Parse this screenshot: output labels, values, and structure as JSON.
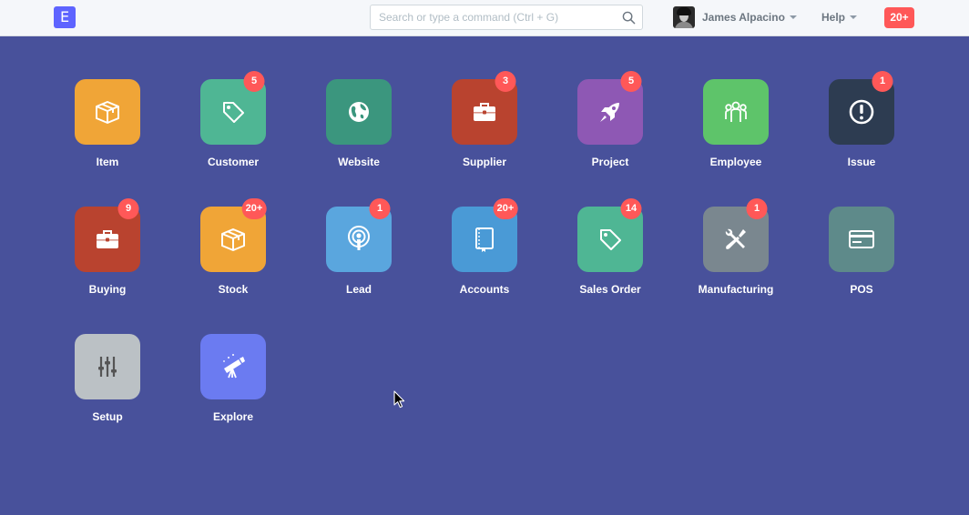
{
  "brand": {
    "letter": "E"
  },
  "search": {
    "placeholder": "Search or type a command (Ctrl + G)"
  },
  "user": {
    "name": "James Alpacino"
  },
  "help": {
    "label": "Help"
  },
  "notifications": {
    "count": "20+"
  },
  "colors": {
    "background": "#48519b",
    "navbar": "#f5f7fa",
    "badge": "#ff5858",
    "brand": "#5e64ff"
  },
  "modules": [
    {
      "label": "Item",
      "badge": "",
      "icon": "box-icon",
      "color": "#f0a537"
    },
    {
      "label": "Customer",
      "badge": "5",
      "icon": "tag-icon",
      "color": "#4fb694"
    },
    {
      "label": "Website",
      "badge": "",
      "icon": "globe-icon",
      "color": "#3b967e"
    },
    {
      "label": "Supplier",
      "badge": "3",
      "icon": "briefcase-icon",
      "color": "#b9432f"
    },
    {
      "label": "Project",
      "badge": "5",
      "icon": "rocket-icon",
      "color": "#8e58b4"
    },
    {
      "label": "Employee",
      "badge": "",
      "icon": "group-icon",
      "color": "#5ec46a"
    },
    {
      "label": "Issue",
      "badge": "1",
      "icon": "exclamation-icon",
      "color": "#2d3c51"
    },
    {
      "label": "Buying",
      "badge": "9",
      "icon": "briefcase-icon",
      "color": "#b9432f"
    },
    {
      "label": "Stock",
      "badge": "20+",
      "icon": "box-icon",
      "color": "#f0a537"
    },
    {
      "label": "Lead",
      "badge": "1",
      "icon": "podcast-icon",
      "color": "#5aa6de"
    },
    {
      "label": "Accounts",
      "badge": "20+",
      "icon": "book-icon",
      "color": "#4a9ad6"
    },
    {
      "label": "Sales Order",
      "badge": "14",
      "icon": "tag-icon",
      "color": "#4fb694"
    },
    {
      "label": "Manufacturing",
      "badge": "1",
      "icon": "tools-icon",
      "color": "#7a878f"
    },
    {
      "label": "POS",
      "badge": "",
      "icon": "credit-card-icon",
      "color": "#5e8a8a"
    },
    {
      "label": "Setup",
      "badge": "",
      "icon": "sliders-icon",
      "color": "#bbc1c5"
    },
    {
      "label": "Explore",
      "badge": "",
      "icon": "telescope-icon",
      "color": "#6b7bf1"
    }
  ]
}
